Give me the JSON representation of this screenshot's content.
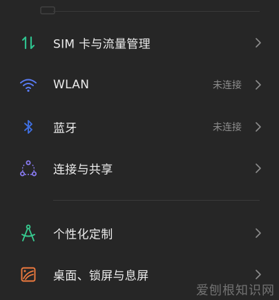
{
  "colors": {
    "background": "#262626",
    "divider": "#3a3a3a",
    "text_primary": "#ececec",
    "text_secondary": "#8d8d8d",
    "sim_icon": "#2fc28f",
    "wlan_icon": "#5a7cf5",
    "bluetooth_icon": "#3f6fe0",
    "share_icon": "#8a7cf5",
    "personalize_icon": "#37c98f",
    "desktop_icon": "#f07b3f"
  },
  "settings": {
    "items": [
      {
        "icon": "data-arrows-icon",
        "label": "SIM 卡与流量管理",
        "status": ""
      },
      {
        "icon": "wifi-icon",
        "label": "WLAN",
        "status": "未连接"
      },
      {
        "icon": "bluetooth-icon",
        "label": "蓝牙",
        "status": "未连接"
      },
      {
        "icon": "share-nodes-icon",
        "label": "连接与共享",
        "status": ""
      },
      {
        "icon": "compass-icon",
        "label": "个性化定制",
        "status": ""
      },
      {
        "icon": "wallpaper-icon",
        "label": "桌面、锁屏与息屏",
        "status": ""
      }
    ]
  },
  "watermark": "爱刨根知识网"
}
